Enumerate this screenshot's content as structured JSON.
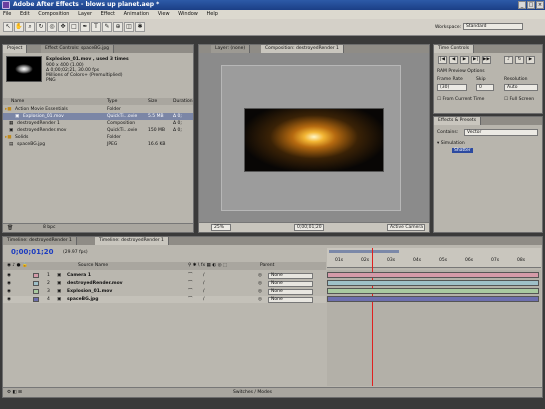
{
  "window": {
    "title": "Adobe After Effects - blows up planet.aep *"
  },
  "menu": [
    "File",
    "Edit",
    "Composition",
    "Layer",
    "Effect",
    "Animation",
    "View",
    "Window",
    "Help"
  ],
  "toolbar": {
    "workspace_label": "Workspace:",
    "workspace_value": "Standard"
  },
  "project": {
    "tabs": [
      "Project",
      "Effect Controls: spaceBG.jpg"
    ],
    "preview_name": "Explosion_01.mov , used 3 times",
    "preview_info": [
      "900 x 400 (1.00)",
      "Δ 0;00;02;21, 30.00 fps",
      "Millions of Colors+ (Premultiplied)",
      "PNG"
    ],
    "columns": [
      "Name",
      "Type",
      "Size",
      "Duration"
    ],
    "items": [
      {
        "name": "Action Movie Essentials",
        "type": "Folder",
        "size": "",
        "dur": ""
      },
      {
        "name": "Explosion_01.mov",
        "type": "QuickTi...ovie",
        "size": "5.5 MB",
        "dur": "Δ 0;"
      },
      {
        "name": "destroyedRender 1",
        "type": "Composition",
        "size": "",
        "dur": "Δ 0;"
      },
      {
        "name": "destroyedRender.mov",
        "type": "QuickTi...ovie",
        "size": "150 MB",
        "dur": "Δ 0;"
      },
      {
        "name": "Solids",
        "type": "Folder",
        "size": "",
        "dur": ""
      },
      {
        "name": "spaceBG.jpg",
        "type": "JPEG",
        "size": "16.6 KB",
        "dur": ""
      }
    ],
    "footer": "8 bpc"
  },
  "viewer": {
    "tabs": [
      "Layer: (none)",
      "Composition: destroyedRender 1"
    ],
    "zoom": "25%",
    "timecode": "0;00;01;20",
    "camera": "Active Camera"
  },
  "time_controls": {
    "tabs": [
      "Time Controls"
    ],
    "ram_preview": "RAM Preview Options",
    "labels": [
      "Frame Rate",
      "Skip",
      "Resolution"
    ],
    "values": [
      "(30)",
      "0",
      "Auto"
    ],
    "from_current": "From Current Time",
    "full_screen": "Full Screen"
  },
  "effects": {
    "tabs": [
      "Effects & Presets"
    ],
    "contains_label": "Contains:",
    "search": "Vector",
    "items": [
      "Simulation",
      "Shatter"
    ]
  },
  "timeline": {
    "tabs": [
      "Timeline: destroyedRender 1",
      "Timeline: destroyedRender 1"
    ],
    "timecode": "0;00;01;20",
    "fps": "(29.97 fps)",
    "col_source": "Source Name",
    "col_parent": "Parent",
    "layers": [
      {
        "num": "1",
        "name": "Camera 1",
        "parent": "None",
        "color": "#d49aa8"
      },
      {
        "num": "2",
        "name": "destroyedRender.mov",
        "parent": "None",
        "color": "#9fc0c8"
      },
      {
        "num": "3",
        "name": "Explosion_01.mov",
        "parent": "None",
        "color": "#a9c9a0"
      },
      {
        "num": "4",
        "name": "spaceBG.jpg",
        "parent": "None",
        "color": "#6d6fae"
      }
    ],
    "ruler": [
      "01s",
      "02s",
      "03s",
      "04s",
      "05s",
      "06s",
      "07s",
      "08s"
    ],
    "current_time_fraction": 0.21,
    "footer": "Switches / Modes"
  }
}
